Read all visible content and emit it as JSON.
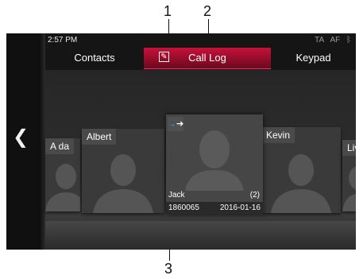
{
  "callouts": {
    "c1": "1",
    "c2": "2",
    "c3": "3"
  },
  "status": {
    "time": "2:57 PM",
    "ta": "TA",
    "af": "AF",
    "bluetooth_icon": "bluetooth-icon"
  },
  "tabs": [
    {
      "label": "Contacts",
      "active": false
    },
    {
      "label": "Call Log",
      "active": true,
      "icon": "edit-icon"
    },
    {
      "label": "Keypad",
      "active": false
    }
  ],
  "nav": {
    "back_icon": "chevron-left-icon"
  },
  "cards": [
    {
      "name": "A da"
    },
    {
      "name": "Albert"
    },
    {
      "name": "Kevin"
    },
    {
      "name": "Livy"
    }
  ],
  "focus": {
    "name": "Jack",
    "count": "(2)",
    "number": "1860065",
    "date": "2016-01-16",
    "call_type_icon": "outgoing-call-icon"
  },
  "colors": {
    "accent": "#c8103a",
    "background": "#151515"
  }
}
